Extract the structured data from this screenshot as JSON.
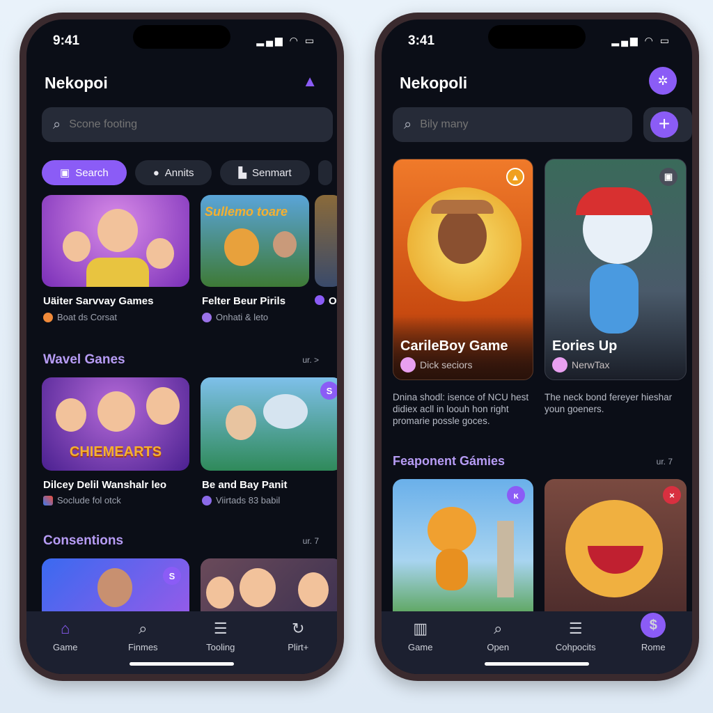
{
  "accent": "#8b5cf6",
  "left": {
    "time": "9:41",
    "app_title": "Nekopoi",
    "search_placeholder": "Scone footing",
    "chips": [
      {
        "label": "Search",
        "icon": "calendar-icon"
      },
      {
        "label": "Annits",
        "icon": "apple-icon"
      },
      {
        "label": "Senmart",
        "icon": "store-icon"
      }
    ],
    "row1": [
      {
        "title": "Uäiter Sarvvay Games",
        "sub": "Boat ds Corsat"
      },
      {
        "title": "Felter Beur Pirils",
        "sub": "Onhati & leto"
      },
      {
        "title": "Oi",
        "sub": ""
      }
    ],
    "section1": {
      "title": "Wavel Ganes",
      "more": "ur. >"
    },
    "row2": [
      {
        "title": "Dilcey Delil Wanshalr leo",
        "sub": "Soclude fol otck",
        "banner": "CHIEMEARTS"
      },
      {
        "title": "Be and Bay Panit",
        "sub": "Viirtads 83 babil",
        "badge": "S"
      }
    ],
    "section2": {
      "title": "Consentions",
      "more": "ur. 7"
    },
    "row3_badge": "S",
    "card_banner": "Sullemo toare",
    "tabs": [
      {
        "label": "Game",
        "icon": "home-icon"
      },
      {
        "label": "Finmes",
        "icon": "search-icon"
      },
      {
        "label": "Tooling",
        "icon": "tools-icon"
      },
      {
        "label": "Plirt+",
        "icon": "refresh-icon"
      }
    ]
  },
  "right": {
    "time": "3:41",
    "app_title": "Nekopoli",
    "search_placeholder": "Bily many",
    "featured": [
      {
        "title": "CarileBoy Game",
        "sub": "Dick seciors",
        "desc": "Dnina shodl: isence of NCU hest didiex acll in loouh hon right promarie possle goces."
      },
      {
        "title": "Eories Up",
        "sub": "NerwTax",
        "desc": "The neck bond fereyer hieshar youn goeners."
      }
    ],
    "section": {
      "title": "Feaponent Gámies",
      "more": "ur. 7"
    },
    "row_badges": [
      "ĸ",
      "×"
    ],
    "tabs": [
      {
        "label": "Game",
        "icon": "library-icon"
      },
      {
        "label": "Open",
        "icon": "search-icon"
      },
      {
        "label": "Cohpocits",
        "icon": "list-icon"
      },
      {
        "label": "Rome",
        "icon": "dollar-icon"
      }
    ],
    "active_tab_symbol": "$"
  }
}
